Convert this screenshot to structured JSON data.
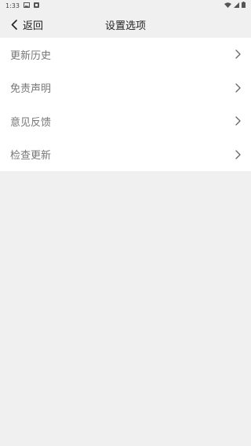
{
  "status_bar": {
    "time": "1:33",
    "icons": [
      "image-icon",
      "notification-icon",
      "wifi-icon",
      "signal-icon",
      "battery-icon"
    ]
  },
  "header": {
    "back_label": "返回",
    "title": "设置选项"
  },
  "menu": {
    "items": [
      {
        "label": "更新历史",
        "icon": "chevron-right-icon"
      },
      {
        "label": "免责声明",
        "icon": "chevron-right-icon"
      },
      {
        "label": "意见反馈",
        "icon": "chevron-right-icon"
      },
      {
        "label": "检查更新",
        "icon": "chevron-right-icon"
      }
    ]
  },
  "colors": {
    "background": "#f0f0f0",
    "list_background": "#ffffff",
    "label_text": "#777777",
    "title_text": "#222222"
  }
}
